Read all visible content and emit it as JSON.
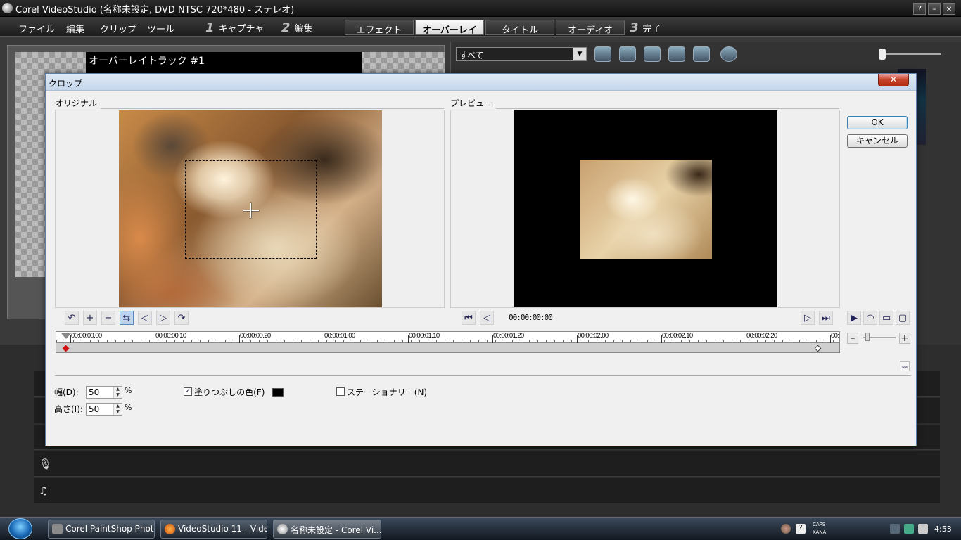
{
  "window": {
    "title": "Corel VideoStudio (名称未設定, DVD NTSC 720*480 - ステレオ)",
    "controls": [
      "?",
      "–",
      "×"
    ]
  },
  "menubar": {
    "items": [
      "ファイル",
      "編集",
      "クリップ",
      "ツール"
    ],
    "steps": [
      {
        "num": "1",
        "label": "キャプチャ"
      },
      {
        "num": "2",
        "label": "編集"
      },
      {
        "num": "3",
        "label": "完了"
      }
    ],
    "tabs": [
      {
        "label": "エフェクト",
        "active": false
      },
      {
        "label": "オーバーレイ",
        "active": true
      },
      {
        "label": "タイトル",
        "active": false
      },
      {
        "label": "オーディオ",
        "active": false
      }
    ]
  },
  "background": {
    "overlay_track_label": "オーバーレイトラック #1",
    "library_filter": "すべて"
  },
  "dialog": {
    "title": "クロップ",
    "close": "✕",
    "original_label": "オリジナル",
    "preview_label": "プレビュー",
    "ok": "OK",
    "cancel": "キャンセル",
    "timecode": "00:00:00:00",
    "ruler_labels": [
      "00:00:00.00",
      "00:00:00.10",
      "00:00:00.20",
      "00:00:01.00",
      "00:00:01.10",
      "00:00:01.20",
      "00:00:02.00",
      "00:00:02.10",
      "00:00:02.20",
      "00:"
    ],
    "width_label": "幅(D):",
    "width_value": "50",
    "height_label": "高さ(I):",
    "height_value": "50",
    "unit": "%",
    "fill_color_label": "塗りつぶしの色(F)",
    "fill_color_checked": true,
    "fill_color": "#000000",
    "stationary_label": "ステーショナリー(N)",
    "stationary_checked": false,
    "zoom_minus": "–",
    "zoom_plus": "+"
  },
  "taskbar": {
    "tasks": [
      {
        "label": "Corel PaintShop Photo...",
        "active": false
      },
      {
        "label": "VideoStudio 11 - Video...",
        "active": false
      },
      {
        "label": "名称未設定 - Corel Vi...",
        "active": true
      }
    ],
    "caps": "CAPS",
    "kana": "KANA",
    "clock": "4:53"
  },
  "colors": {
    "accent": "#3c7fb1",
    "close_red": "#c7442c"
  }
}
